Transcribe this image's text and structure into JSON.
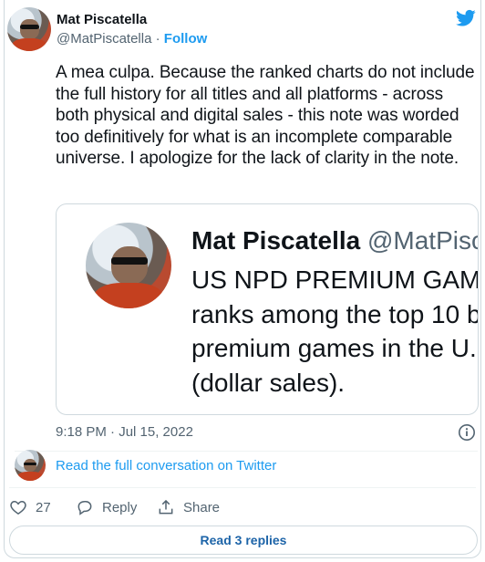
{
  "colors": {
    "accent": "#1d9bf0",
    "text": "#0f1419",
    "muted": "#536471",
    "border": "#cfd9de"
  },
  "author": {
    "name": "Mat Piscatella",
    "handle": "@MatPiscatella",
    "separator": " · ",
    "follow_label": "Follow",
    "avatar_icon": "profile-photo"
  },
  "tweet": {
    "text": "A mea culpa. Because the ranked charts do not include the full history for all titles and all platforms - across both physical and digital sales - this note was worded too definitively for what is an incomplete comparable universe. I apologize for the lack of clarity in the note.",
    "timestamp": "9:18 PM · Jul 15, 2022"
  },
  "quote": {
    "name": "Mat Piscatella",
    "handle": "@MatPisc",
    "lines": "US NPD PREMIUM GAM\nranks among the top 10 b\npremium games in the U.\n(dollar sales)."
  },
  "conversation": {
    "link_label": "Read the full conversation on Twitter"
  },
  "actions": {
    "like_count": "27",
    "reply_label": "Reply",
    "share_label": "Share"
  },
  "replies": {
    "label": "Read 3 replies"
  },
  "icons": [
    "twitter-logo",
    "info-icon",
    "heart-icon",
    "reply-bubble-icon",
    "share-icon"
  ]
}
